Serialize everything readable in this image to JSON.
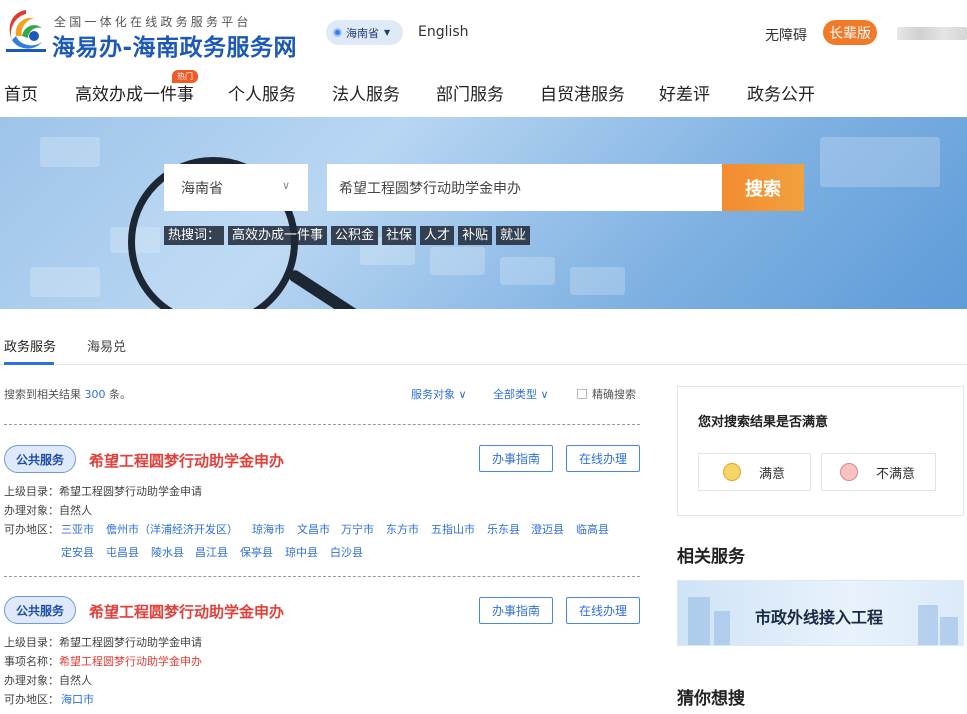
{
  "header": {
    "logo_subtitle": "全国一体化在线政务服务平台",
    "logo_title": "海易办-海南政务服务网",
    "region_pill": "海南省",
    "lang_link": "English",
    "accessibility_link": "无障碍",
    "elder_mode_button": "长辈版"
  },
  "nav": {
    "items": [
      {
        "label": "首页"
      },
      {
        "label": "高效办成一件事"
      },
      {
        "label": "个人服务"
      },
      {
        "label": "法人服务"
      },
      {
        "label": "部门服务"
      },
      {
        "label": "自贸港服务"
      },
      {
        "label": "好差评"
      },
      {
        "label": "政务公开"
      }
    ],
    "hot_tag": "热门"
  },
  "search": {
    "region_value": "海南省",
    "query": "希望工程圆梦行动助学金申办",
    "button_label": "搜索",
    "hot_label": "热搜词：",
    "hot_words": [
      "高效办成一件事",
      "公积金",
      "社保",
      "人才",
      "补贴",
      "就业"
    ]
  },
  "tabs": [
    {
      "label": "政务服务"
    },
    {
      "label": "海易兑"
    }
  ],
  "results": {
    "summary_prefix": "搜索到相关结果",
    "summary_count": "300",
    "summary_suffix": "条。",
    "filter_target": "服务对象",
    "filter_type": "全部类型",
    "exact_label": "精确搜索",
    "items": [
      {
        "badge": "公共服务",
        "title": "希望工程圆梦行动助学金申办",
        "guide_button": "办事指南",
        "online_button": "在线办理",
        "parent_label": "上级目录：",
        "parent_value": "希望工程圆梦行动助学金申请",
        "target_label": "办理对象：",
        "target_value": "自然人",
        "area_label": "可办地区：",
        "areas": [
          "三亚市",
          "儋州市（洋浦经济开发区）",
          "琼海市",
          "文昌市",
          "万宁市",
          "东方市",
          "五指山市",
          "乐东县",
          "澄迈县",
          "临高县",
          "定安县",
          "屯昌县",
          "陵水县",
          "昌江县",
          "保亭县",
          "琼中县",
          "白沙县"
        ]
      },
      {
        "badge": "公共服务",
        "title": "希望工程圆梦行动助学金申办",
        "guide_button": "办事指南",
        "online_button": "在线办理",
        "parent_label": "上级目录：",
        "parent_value": "希望工程圆梦行动助学金申请",
        "item_label": "事项名称：",
        "item_value": "希望工程圆梦行动助学金申办",
        "target_label": "办理对象：",
        "target_value": "自然人",
        "area_label": "可办地区：",
        "areas": [
          "海口市"
        ]
      }
    ]
  },
  "sidebar": {
    "satisfaction_question": "您对搜索结果是否满意",
    "satisfied": "满意",
    "unsatisfied": "不满意",
    "related_heading": "相关服务",
    "related_item": "市政外线接入工程",
    "guess_heading": "猜你想搜"
  },
  "colors": {
    "brand_blue": "#2f6fde",
    "accent_orange": "#f07a28",
    "title_red": "#e2403a"
  }
}
